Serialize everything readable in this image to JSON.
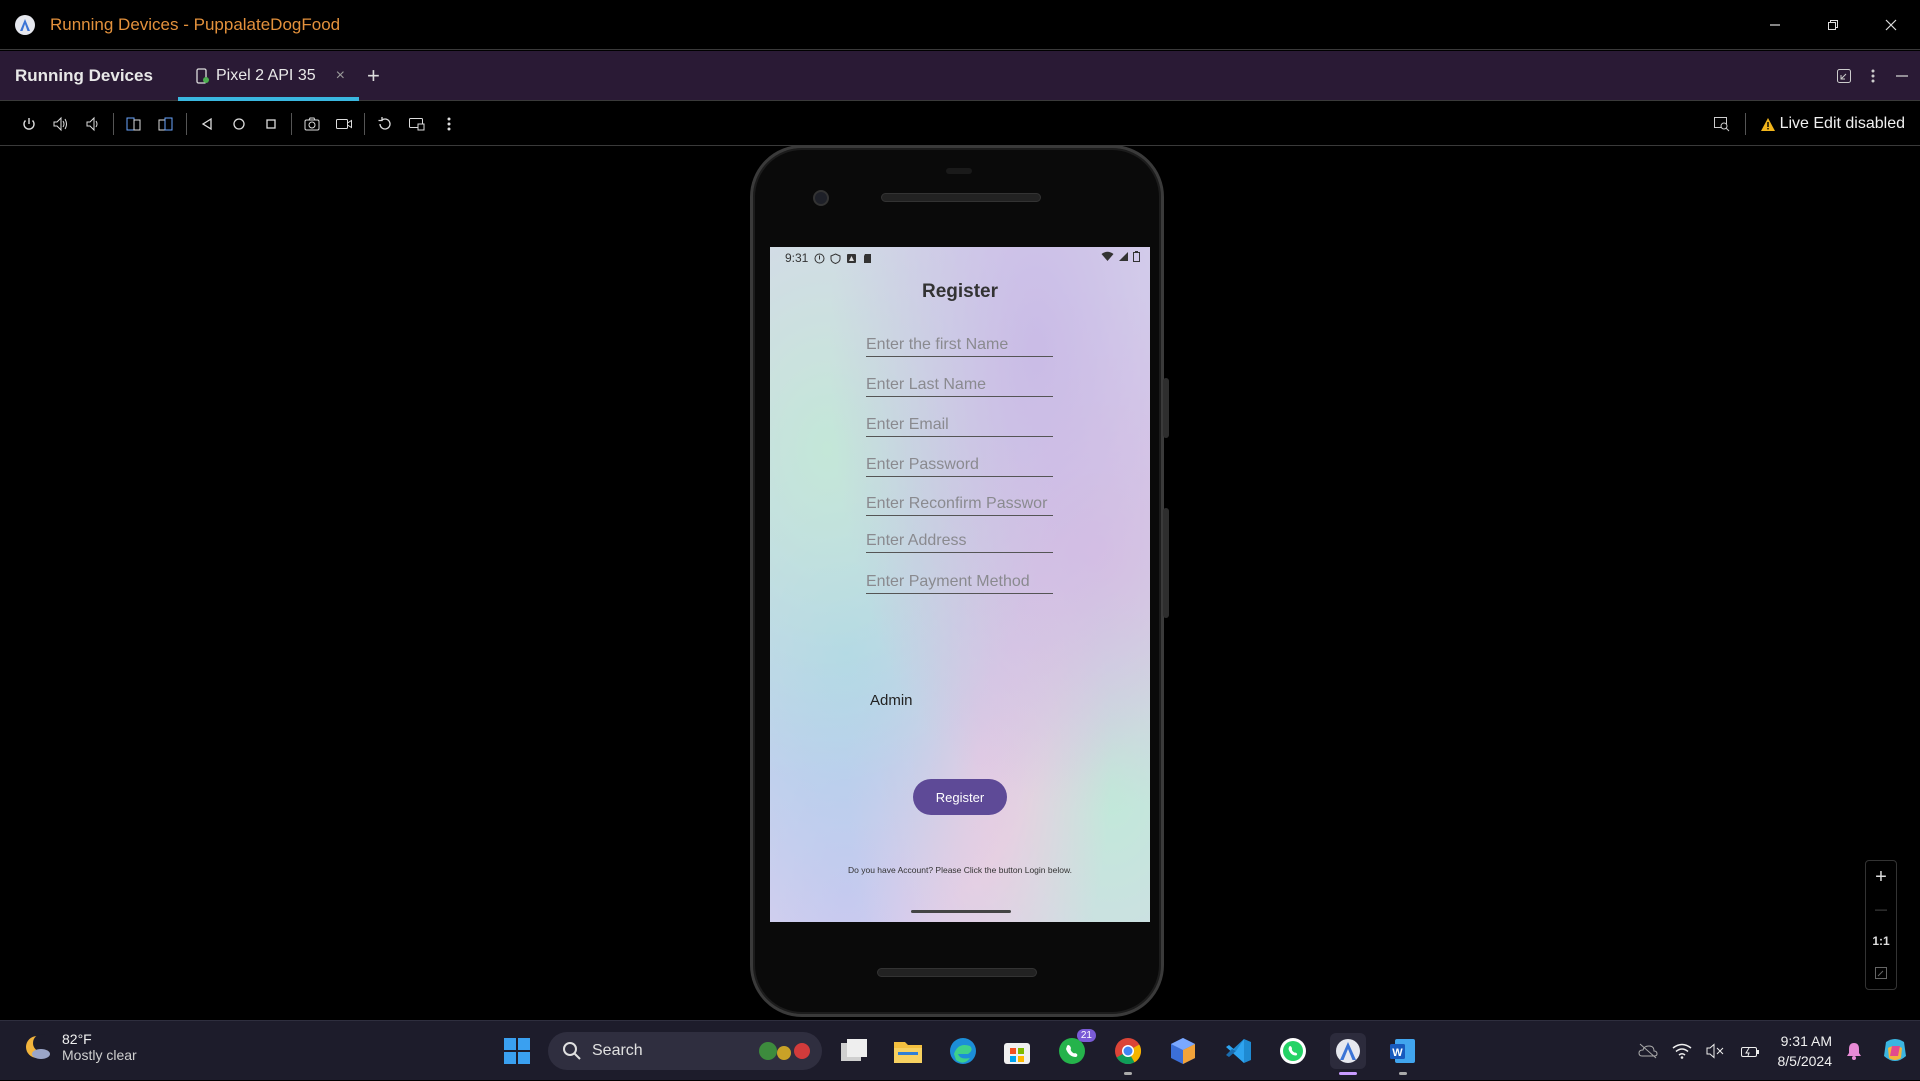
{
  "window": {
    "title": "Running Devices - PuppalateDogFood",
    "accent": "#e3913c"
  },
  "tabstrip": {
    "panel_title": "Running Devices",
    "tabs": [
      {
        "label": "Pixel 2 API 35",
        "close": "×"
      }
    ],
    "add_label": "+"
  },
  "toolbar": {
    "live_edit_label": "Live Edit disabled",
    "icons": [
      "power-icon",
      "volume-up-icon",
      "volume-down-icon",
      "rotate-left-icon",
      "rotate-right-icon",
      "back-icon",
      "home-icon",
      "overview-icon",
      "screenshot-icon",
      "screen-record-icon",
      "reset-icon",
      "device-frame-icon",
      "more-icon"
    ]
  },
  "device": {
    "status_time": "9:31",
    "app_title": "Register",
    "fields": [
      "Enter the first Name",
      "Enter Last Name",
      "Enter Email",
      "Enter Password",
      "Enter Reconfirm Passwor",
      "Enter Address",
      "Enter Payment Method"
    ],
    "role_label": "Admin",
    "register_button": "Register",
    "login_hint": "Do you have Account? Please Click the button Login below."
  },
  "zoom": {
    "plus": "+",
    "minus": "—",
    "actual": "1:1"
  },
  "taskbar": {
    "weather_temp": "82°F",
    "weather_cond": "Mostly clear",
    "search_label": "Search",
    "whatsapp_badge": "21",
    "time": "9:31 AM",
    "date": "8/5/2024"
  }
}
